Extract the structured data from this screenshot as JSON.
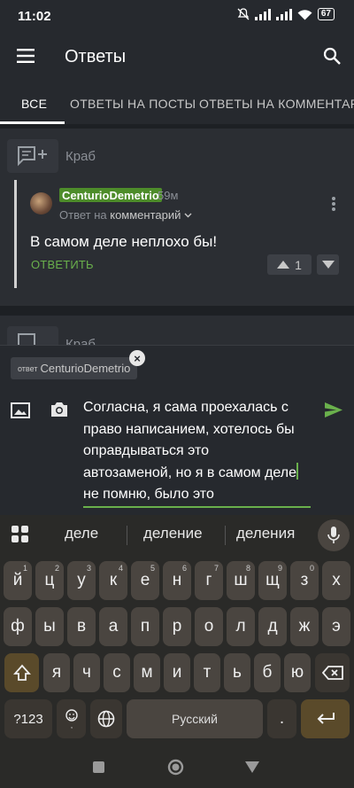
{
  "status": {
    "time": "11:02",
    "battery": "67"
  },
  "toolbar": {
    "title": "Ответы"
  },
  "tabs": [
    {
      "label": "ВСЕ",
      "active": true
    },
    {
      "label": "ОТВЕТЫ НА ПОСТЫ",
      "active": false
    },
    {
      "label": "ОТВЕТЫ НА КОММЕНТАРИИ",
      "active": false
    }
  ],
  "post": {
    "label": "Краб"
  },
  "post2": {
    "label": "Краб"
  },
  "comment": {
    "username": "CenturioDemetrio",
    "time_ago": "59м",
    "reply_prefix": "Ответ на",
    "reply_target": "комментарий",
    "text": "В самом деле неплохо бы!",
    "reply_label": "ОТВЕТИТЬ",
    "votes": "1"
  },
  "composer": {
    "chip_prefix": "ответ",
    "chip_name": "CenturioDemetrio",
    "line1": "Согласна, я сама проехалась с",
    "line2": "право написанием, хотелось бы",
    "line3": "оправдываться это",
    "line4": "автозаменой, но я в самом деле",
    "line5": "не помню, было это"
  },
  "keyboard": {
    "suggestions": [
      "деле",
      "деление",
      "деления"
    ],
    "row1": [
      [
        "й",
        "1"
      ],
      [
        "ц",
        "2"
      ],
      [
        "у",
        "3"
      ],
      [
        "к",
        "4"
      ],
      [
        "е",
        "5"
      ],
      [
        "н",
        "6"
      ],
      [
        "г",
        "7"
      ],
      [
        "ш",
        "8"
      ],
      [
        "щ",
        "9"
      ],
      [
        "з",
        "0"
      ],
      [
        "х",
        ""
      ]
    ],
    "row2": [
      "ф",
      "ы",
      "в",
      "а",
      "п",
      "р",
      "о",
      "л",
      "д",
      "ж",
      "э"
    ],
    "row3": [
      "я",
      "ч",
      "с",
      "м",
      "и",
      "т",
      "ь",
      "б",
      "ю"
    ],
    "numbers_label": "?123",
    "space_label": "Русский",
    "period_label": "."
  }
}
